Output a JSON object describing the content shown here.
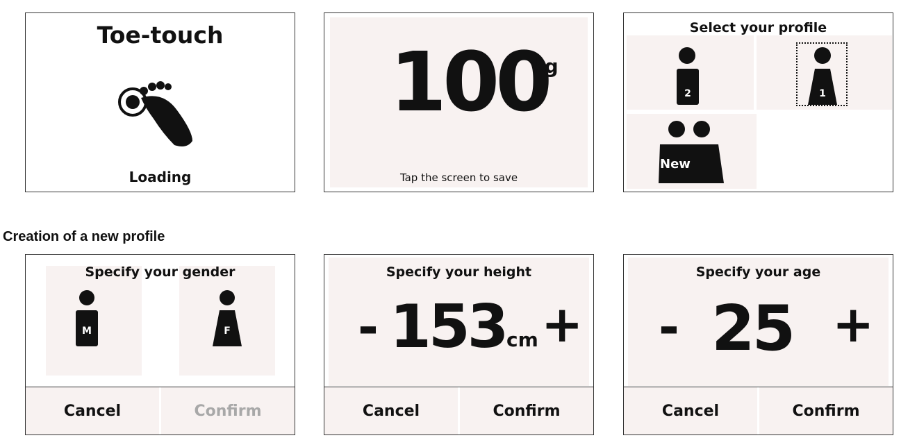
{
  "loading_screen": {
    "title": "Toe-touch",
    "status": "Loading",
    "icon": "foot-touch-icon"
  },
  "weight_screen": {
    "value": "100",
    "unit": "kg",
    "hint": "Tap the screen to save"
  },
  "profile_screen": {
    "title": "Select your profile",
    "profiles": [
      {
        "label": "2",
        "icon": "male-user-icon"
      },
      {
        "label": "1",
        "icon": "female-user-icon",
        "selected": true
      },
      {
        "label": "New",
        "icon": "add-users-icon"
      }
    ]
  },
  "section_label": "Creation of a new profile",
  "gender_screen": {
    "title": "Specify your gender",
    "options": [
      {
        "label": "M",
        "icon": "male-user-icon"
      },
      {
        "label": "F",
        "icon": "female-user-icon"
      }
    ],
    "cancel": "Cancel",
    "confirm": "Confirm",
    "confirm_color": "#a8a8a8"
  },
  "height_screen": {
    "title": "Specify your height",
    "minus": "-",
    "value": "153",
    "unit": "cm",
    "plus": "+",
    "cancel": "Cancel",
    "confirm": "Confirm"
  },
  "age_screen": {
    "title": "Specify your age",
    "minus": "-",
    "value": "25",
    "plus": "+",
    "cancel": "Cancel",
    "confirm": "Confirm"
  },
  "colors": {
    "panel_bg": "#f8f2f1",
    "text": "#111111",
    "border": "#333333"
  }
}
